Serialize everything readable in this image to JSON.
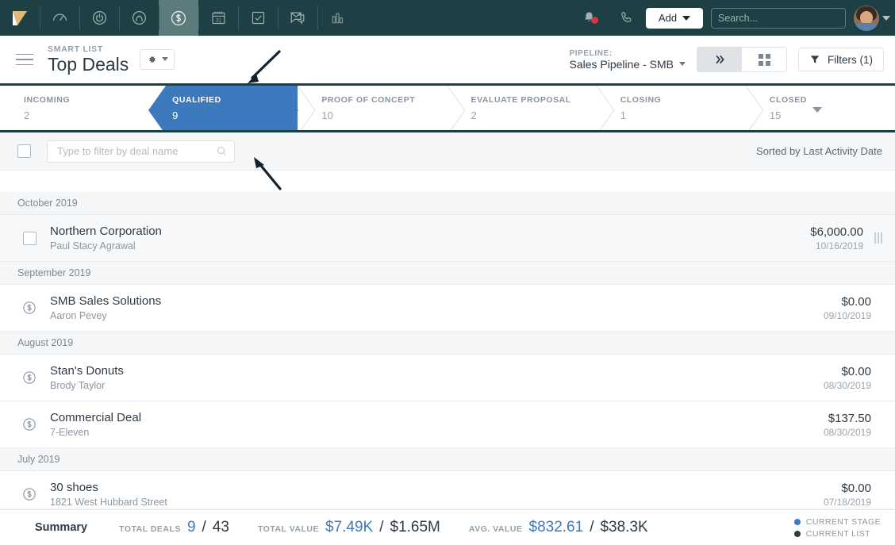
{
  "topnav": {
    "background": "#1d4044",
    "icons": [
      {
        "name": "logo-icon",
        "label": "Logo"
      },
      {
        "name": "dashboard-gauge-icon",
        "label": "Dashboard"
      },
      {
        "name": "power-person-icon",
        "label": "Contacts"
      },
      {
        "name": "person-circle-icon",
        "label": "Leads"
      },
      {
        "name": "dollar-circle-icon",
        "label": "Deals"
      },
      {
        "name": "calendar-31-icon",
        "label": "Calendar"
      },
      {
        "name": "checkbox-task-icon",
        "label": "Tasks"
      },
      {
        "name": "email-chat-icon",
        "label": "Email"
      },
      {
        "name": "bar-chart-icon",
        "label": "Reports"
      }
    ],
    "active_icon": "dollar-circle-icon",
    "notification_badge": true,
    "add_button": "Add",
    "search": {
      "value": "",
      "placeholder": "Search..."
    }
  },
  "header": {
    "eyebrow": "SMART LIST",
    "title": "Top Deals",
    "pipeline_label": "PIPELINE:",
    "pipeline_value": "Sales Pipeline - SMB",
    "filters_label": "Filters (1)",
    "view_list_active": true
  },
  "stages": [
    {
      "label": "INCOMING",
      "count": "2",
      "active": false
    },
    {
      "label": "QUALIFIED",
      "count": "9",
      "active": true
    },
    {
      "label": "PROOF OF CONCEPT",
      "count": "10",
      "active": false
    },
    {
      "label": "EVALUATE PROPOSAL",
      "count": "2",
      "active": false
    },
    {
      "label": "CLOSING",
      "count": "1",
      "active": false
    },
    {
      "label": "CLOSED",
      "count": "15",
      "active": false,
      "has_caret": true
    }
  ],
  "filterbar": {
    "filter_input": {
      "value": "",
      "placeholder": "Type to filter by deal name"
    },
    "sorted_by": "Sorted by Last Activity Date"
  },
  "groups": [
    {
      "heading": "October 2019",
      "rows": [
        {
          "name": "Northern Corporation",
          "sub": "Paul Stacy Agrawal",
          "amount": "$6,000.00",
          "date": "10/16/2019",
          "icon": "checkbox",
          "hover": true,
          "drag": true
        }
      ]
    },
    {
      "heading": "September 2019",
      "rows": [
        {
          "name": "SMB Sales Solutions",
          "sub": "Aaron Pevey",
          "amount": "$0.00",
          "date": "09/10/2019",
          "icon": "dollar",
          "hover": false,
          "drag": false
        }
      ]
    },
    {
      "heading": "August 2019",
      "rows": [
        {
          "name": "Stan's Donuts",
          "sub": "Brody Taylor",
          "amount": "$0.00",
          "date": "08/30/2019",
          "icon": "dollar",
          "hover": false,
          "drag": false
        },
        {
          "name": "Commercial Deal",
          "sub": "7-Eleven",
          "amount": "$137.50",
          "date": "08/30/2019",
          "icon": "dollar",
          "hover": false,
          "drag": false
        }
      ]
    },
    {
      "heading": "July 2019",
      "rows": [
        {
          "name": "30 shoes",
          "sub": "1821 West Hubbard Street",
          "amount": "$0.00",
          "date": "07/18/2019",
          "icon": "dollar",
          "hover": false,
          "drag": false
        }
      ]
    }
  ],
  "summary": {
    "title": "Summary",
    "metrics": [
      {
        "label": "TOTAL DEALS",
        "primary": "9",
        "secondary": "43"
      },
      {
        "label": "TOTAL VALUE",
        "primary": "$7.49K",
        "secondary": "$1.65M"
      },
      {
        "label": "AVG. VALUE",
        "primary": "$832.61",
        "secondary": "$38.3K"
      }
    ],
    "separator": "/",
    "legend": [
      {
        "label": "CURRENT STAGE",
        "color": "#3d79bd"
      },
      {
        "label": "CURRENT LIST",
        "color": "#2f3a45"
      }
    ]
  },
  "accent": {
    "blue": "#3d79bd",
    "dark": "#1d4044"
  }
}
